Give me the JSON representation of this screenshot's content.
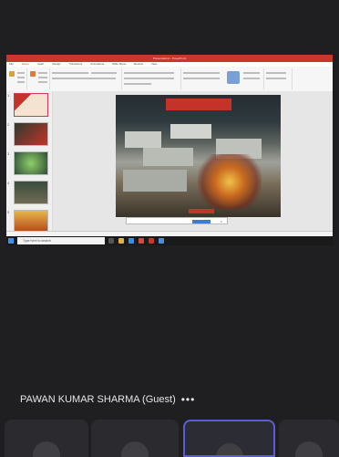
{
  "screen_share": {
    "window_title": "Presentation1 - PowerPoint",
    "ribbon_tabs": [
      "File",
      "Home",
      "Insert",
      "Design",
      "Transitions",
      "Animations",
      "Slide Show",
      "Review",
      "View"
    ],
    "slide_numbers": [
      "1",
      "2",
      "3",
      "4",
      "5"
    ],
    "slide_title": "",
    "toast_text": "",
    "status_text": "",
    "search_placeholder": "Type here to search",
    "tray_text": ""
  },
  "participant": {
    "name": "PAWAN KUMAR SHARMA (Guest)",
    "more_icon": "more-options-icon",
    "more_label": "•••"
  },
  "colors": {
    "accent": "#5b5cd6",
    "ppt_red": "#c9372c",
    "background": "#1f1f22"
  }
}
